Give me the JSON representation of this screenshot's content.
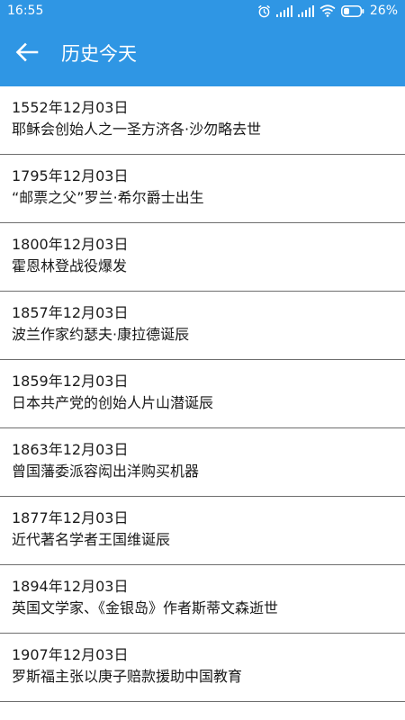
{
  "status_bar": {
    "time": "16:55",
    "battery": "26%",
    "icons": [
      "alarm-icon",
      "signal-icon",
      "signal-icon",
      "wifi-icon",
      "battery-icon"
    ]
  },
  "header": {
    "back_icon": "arrow-left-icon",
    "title": "历史今天"
  },
  "events": [
    {
      "date": "1552年12月03日",
      "desc": "耶稣会创始人之一圣方济各·沙勿略去世"
    },
    {
      "date": "1795年12月03日",
      "desc": "“邮票之父”罗兰·希尔爵士出生"
    },
    {
      "date": "1800年12月03日",
      "desc": "霍恩林登战役爆发"
    },
    {
      "date": "1857年12月03日",
      "desc": "波兰作家约瑟夫·康拉德诞辰"
    },
    {
      "date": "1859年12月03日",
      "desc": "日本共产党的创始人片山潜诞辰"
    },
    {
      "date": "1863年12月03日",
      "desc": "曾国藩委派容闳出洋购买机器"
    },
    {
      "date": "1877年12月03日",
      "desc": "近代著名学者王国维诞辰"
    },
    {
      "date": "1894年12月03日",
      "desc": "英国文学家、《金银岛》作者斯蒂文森逝世"
    },
    {
      "date": "1907年12月03日",
      "desc": "罗斯福主张以庚子赔款援助中国教育"
    }
  ],
  "colors": {
    "primary": "#2f96e4",
    "divider": "#6e6e6e",
    "text": "#1a1a1a"
  }
}
